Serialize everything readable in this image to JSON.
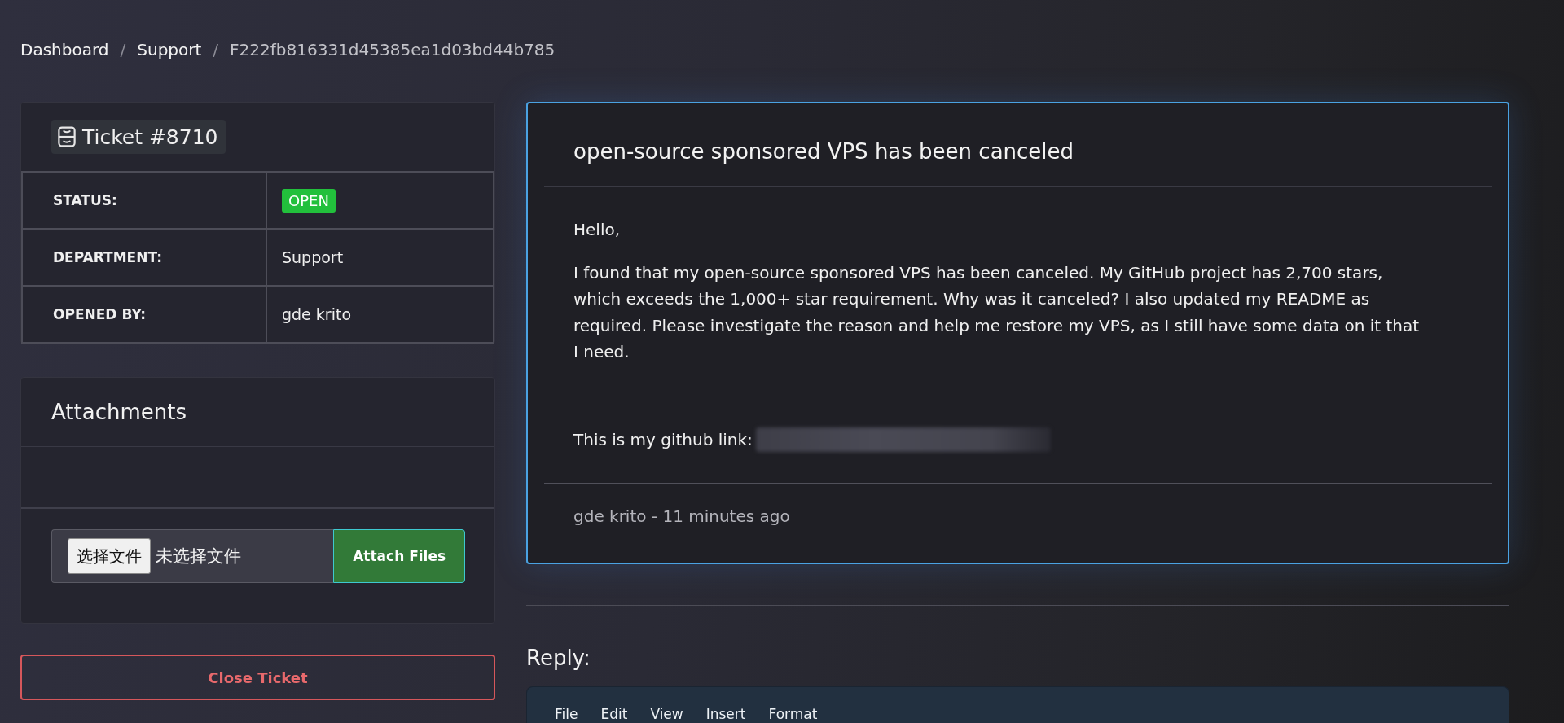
{
  "breadcrumb": [
    {
      "kind": "link",
      "label": "Dashboard"
    },
    {
      "kind": "separator",
      "label": "/"
    },
    {
      "kind": "link",
      "label": "Support"
    },
    {
      "kind": "separator",
      "label": "/"
    },
    {
      "kind": "current",
      "label": "F222fb816331d45385ea1d03bd44b785"
    }
  ],
  "ticket": {
    "title": "Ticket #8710",
    "fields": [
      {
        "kind": "badge",
        "label": "STATUS:",
        "value": "OPEN"
      },
      {
        "kind": "text",
        "label": "DEPARTMENT:",
        "value": "Support"
      },
      {
        "kind": "text",
        "label": "OPENED BY:",
        "value": "gde krito"
      }
    ]
  },
  "attachments": {
    "title": "Attachments",
    "file_input": {
      "button": "选择文件",
      "value": "未选择文件"
    },
    "attach_button": "Attach Files"
  },
  "close_button": "Close Ticket",
  "message": {
    "subject": "open-source sponsored VPS has been canceled",
    "paragraphs": [
      {
        "kind": "text",
        "text": "Hello,"
      },
      {
        "kind": "text",
        "text": "I found that my open-source sponsored VPS has been canceled. My GitHub project has 2,700 stars, which exceeds the 1,000+ star requirement. Why was it canceled? I also updated my README as required. Please investigate the reason and help me restore my VPS, as I still have some data on it that I need."
      },
      {
        "kind": "link",
        "text": "This is my github link:"
      }
    ],
    "footer": "gde krito - 11 minutes ago"
  },
  "reply": {
    "title": "Reply:",
    "menu": [
      "File",
      "Edit",
      "View",
      "Insert",
      "Format"
    ]
  }
}
